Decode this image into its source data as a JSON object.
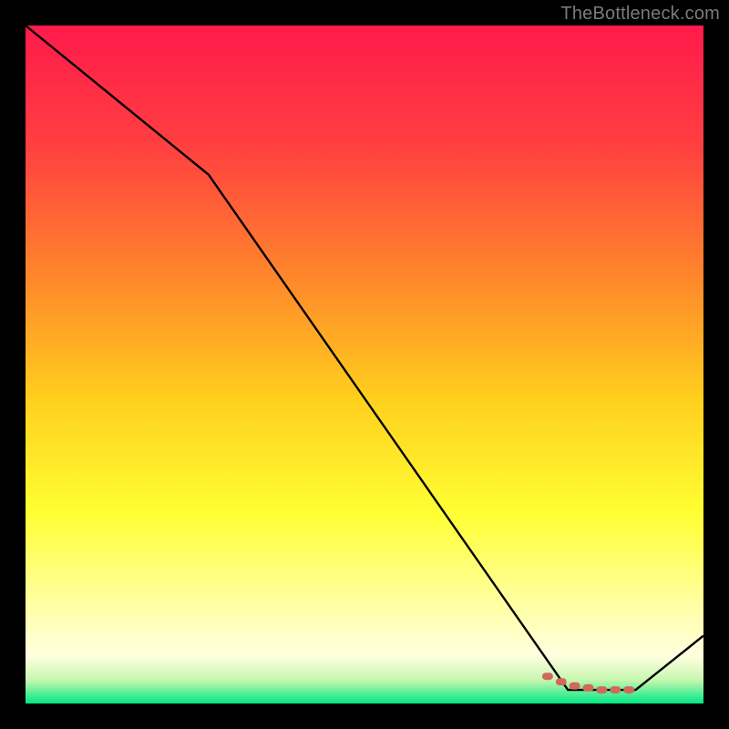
{
  "watermark": "TheBottleneck.com",
  "colors": {
    "top": "#ff1a4b",
    "upper_mid": "#ff6a2e",
    "mid": "#ffbb1e",
    "lower_mid": "#ffff33",
    "pale": "#ffffcc",
    "bottom": "#00e884",
    "frame": "#000000",
    "line": "#000000",
    "marker": "#d1695b"
  },
  "chart_data": {
    "type": "line",
    "title": "",
    "xlabel": "",
    "ylabel": "",
    "xlim": [
      0,
      100
    ],
    "ylim": [
      0,
      100
    ],
    "series": [
      {
        "name": "curve",
        "x": [
          0,
          27,
          80,
          90,
          100
        ],
        "y": [
          100,
          78,
          2,
          2,
          10
        ]
      }
    ],
    "markers": {
      "name": "highlight",
      "x": [
        77,
        79,
        81,
        83,
        85,
        87,
        89
      ],
      "y": [
        4,
        3.2,
        2.6,
        2.3,
        2,
        2,
        2
      ]
    },
    "gradient_stops": [
      {
        "offset": 0.0,
        "color": "#ff1a4b"
      },
      {
        "offset": 0.18,
        "color": "#ff4040"
      },
      {
        "offset": 0.38,
        "color": "#ff8a2a"
      },
      {
        "offset": 0.55,
        "color": "#ffcf1e"
      },
      {
        "offset": 0.72,
        "color": "#ffff33"
      },
      {
        "offset": 0.85,
        "color": "#ffffa0"
      },
      {
        "offset": 0.93,
        "color": "#ffffe0"
      },
      {
        "offset": 0.965,
        "color": "#c8f7b0"
      },
      {
        "offset": 1.0,
        "color": "#00e884"
      }
    ]
  }
}
